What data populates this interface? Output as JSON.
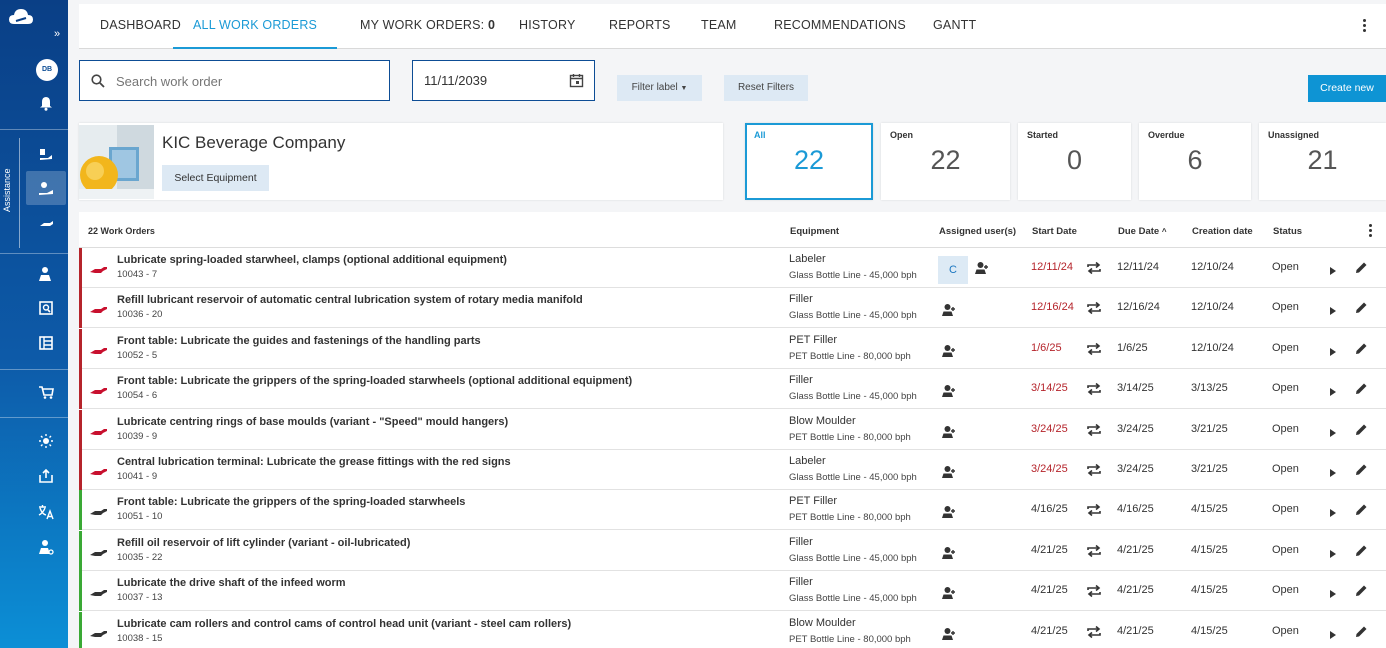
{
  "colors": {
    "accent": "#1b9ad6",
    "primary_dark": "#0d4d95",
    "overdue_red": "#b5242b",
    "ok_green": "#3aa935"
  },
  "sidebar": {
    "avatar_initials": "DB",
    "section_label": "Assistance",
    "icons": [
      "cloud-logo-icon",
      "bell-icon",
      "hand-tool-icon",
      "maintenance-hand-icon",
      "lubrication-icon",
      "person-task-icon",
      "document-search-icon",
      "layout-icon",
      "cart-icon",
      "sun-settings-icon",
      "upload-icon",
      "translate-icon",
      "user-gear-icon"
    ]
  },
  "tabs": [
    {
      "label": "DASHBOARD"
    },
    {
      "label": "ALL WORK ORDERS"
    },
    {
      "label": "MY WORK ORDERS:",
      "count": "0"
    },
    {
      "label": "HISTORY"
    },
    {
      "label": "REPORTS"
    },
    {
      "label": "TEAM"
    },
    {
      "label": "RECOMMENDATIONS"
    },
    {
      "label": "GANTT"
    }
  ],
  "filters": {
    "search_placeholder": "Search work order",
    "date_value": "11/11/2039",
    "filter_label": "Filter label",
    "reset_label": "Reset Filters",
    "create_label": "Create new"
  },
  "company": {
    "name": "KIC Beverage Company",
    "select_label": "Select Equipment"
  },
  "stats": [
    {
      "label": "All",
      "value": "22"
    },
    {
      "label": "Open",
      "value": "22"
    },
    {
      "label": "Started",
      "value": "0"
    },
    {
      "label": "Overdue",
      "value": "6"
    },
    {
      "label": "Unassigned",
      "value": "21"
    }
  ],
  "table": {
    "count_label": "22 Work Orders",
    "columns": {
      "equipment": "Equipment",
      "assigned": "Assigned user(s)",
      "start": "Start Date",
      "due": "Due Date",
      "created": "Creation date",
      "status": "Status"
    },
    "rows": [
      {
        "title": "Lubricate spring-loaded starwheel, clamps (optional additional equipment)",
        "id": "10043 - 7",
        "equipment": "Labeler",
        "line": "Glass Bottle Line - 45,000 bph",
        "assignee": "C",
        "start": "12/11/24",
        "due": "12/11/24",
        "created": "12/10/24",
        "status": "Open",
        "overdue": true
      },
      {
        "title": "Refill lubricant reservoir of automatic central lubrication system of rotary media manifold",
        "id": "10036 - 20",
        "equipment": "Filler",
        "line": "Glass Bottle Line - 45,000 bph",
        "assignee": "",
        "start": "12/16/24",
        "due": "12/16/24",
        "created": "12/10/24",
        "status": "Open",
        "overdue": true
      },
      {
        "title": "Front table: Lubricate the guides and fastenings of the handling parts",
        "id": "10052 - 5",
        "equipment": "PET Filler",
        "line": "PET Bottle Line - 80,000 bph",
        "assignee": "",
        "start": "1/6/25",
        "due": "1/6/25",
        "created": "12/10/24",
        "status": "Open",
        "overdue": true
      },
      {
        "title": "Front table: Lubricate the grippers of the spring-loaded starwheels (optional additional equipment)",
        "id": "10054 - 6",
        "equipment": "Filler",
        "line": "Glass Bottle Line - 45,000 bph",
        "assignee": "",
        "start": "3/14/25",
        "due": "3/14/25",
        "created": "3/13/25",
        "status": "Open",
        "overdue": true
      },
      {
        "title": "Lubricate centring rings of base moulds (variant - \"Speed\" mould hangers)",
        "id": "10039 - 9",
        "equipment": "Blow Moulder",
        "line": "PET Bottle Line - 80,000 bph",
        "assignee": "",
        "start": "3/24/25",
        "due": "3/24/25",
        "created": "3/21/25",
        "status": "Open",
        "overdue": true
      },
      {
        "title": "Central lubrication terminal: Lubricate the grease fittings with the red signs",
        "id": "10041 - 9",
        "equipment": "Labeler",
        "line": "Glass Bottle Line - 45,000 bph",
        "assignee": "",
        "start": "3/24/25",
        "due": "3/24/25",
        "created": "3/21/25",
        "status": "Open",
        "overdue": true
      },
      {
        "title": "Front table: Lubricate the grippers of the spring-loaded starwheels",
        "id": "10051 - 10",
        "equipment": "PET Filler",
        "line": "PET Bottle Line - 80,000 bph",
        "assignee": "",
        "start": "4/16/25",
        "due": "4/16/25",
        "created": "4/15/25",
        "status": "Open",
        "overdue": false
      },
      {
        "title": "Refill oil reservoir of lift cylinder (variant - oil-lubricated)",
        "id": "10035 - 22",
        "equipment": "Filler",
        "line": "Glass Bottle Line - 45,000 bph",
        "assignee": "",
        "start": "4/21/25",
        "due": "4/21/25",
        "created": "4/15/25",
        "status": "Open",
        "overdue": false
      },
      {
        "title": "Lubricate the drive shaft of the infeed worm",
        "id": "10037 - 13",
        "equipment": "Filler",
        "line": "Glass Bottle Line - 45,000 bph",
        "assignee": "",
        "start": "4/21/25",
        "due": "4/21/25",
        "created": "4/15/25",
        "status": "Open",
        "overdue": false
      },
      {
        "title": "Lubricate cam rollers and control cams of control head unit (variant - steel cam rollers)",
        "id": "10038 - 15",
        "equipment": "Blow Moulder",
        "line": "PET Bottle Line - 80,000 bph",
        "assignee": "",
        "start": "4/21/25",
        "due": "4/21/25",
        "created": "4/15/25",
        "status": "Open",
        "overdue": false
      }
    ]
  }
}
